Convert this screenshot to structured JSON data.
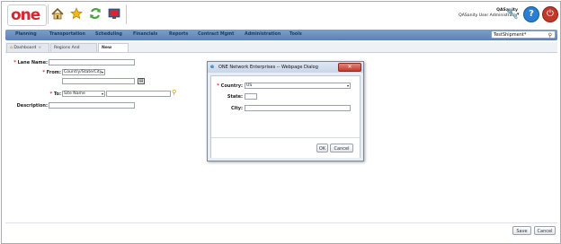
{
  "header": {
    "logo_text": "one",
    "user_name": "QASanity",
    "user_role": "QASanity User Administrator",
    "icons": [
      "home-icon",
      "favorites-star-icon",
      "refresh-icon",
      "alerts-icon"
    ]
  },
  "nav": {
    "items": [
      "Planning",
      "Transportation",
      "Scheduling",
      "Financials",
      "Reports",
      "Contract Mgmt",
      "Administration",
      "Tools"
    ],
    "search_value": "TestShipment*"
  },
  "tabs": [
    {
      "label": "Dashboard",
      "close": "×"
    },
    {
      "label": "Regions And Lanes",
      "close": "×"
    },
    {
      "label": "New Lane",
      "close": "×"
    }
  ],
  "form": {
    "lane_name_label": "Lane Name:",
    "from_label": "From:",
    "from_select": "Country/State/City",
    "to_label": "To:",
    "to_select": "Site Name",
    "description_label": "Description:",
    "required_mark": "*"
  },
  "footer": {
    "save_label": "Save",
    "cancel_label": "Cancel"
  },
  "dialog": {
    "title": "ONE Network Enterprises -- Webpage Dialog",
    "close_symbol": "✕",
    "country_label": "Country:",
    "country_value": "US",
    "state_label": "State:",
    "city_label": "City:",
    "required_mark": "*",
    "ok_label": "OK",
    "cancel_label": "Cancel"
  }
}
